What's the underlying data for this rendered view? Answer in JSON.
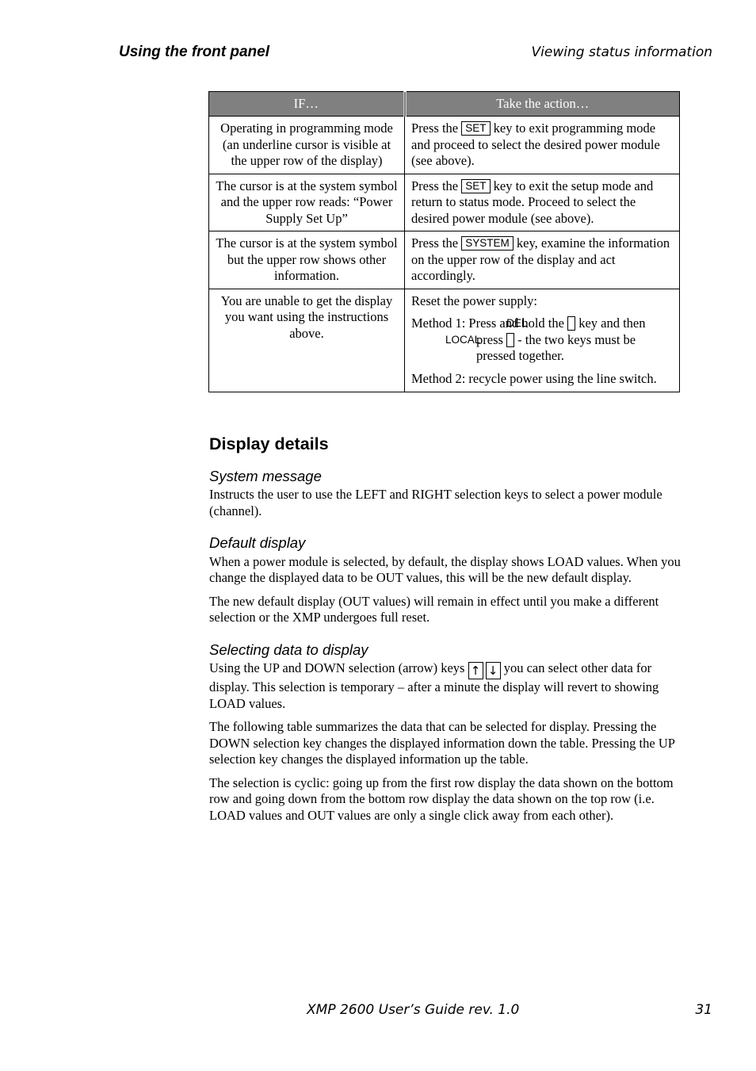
{
  "header": {
    "chapter": "Using the front panel",
    "section": "Viewing status information"
  },
  "table": {
    "headers": [
      "IF…",
      "Take the action…"
    ],
    "rows": [
      {
        "if": "Operating in programming mode (an underline cursor is visible at the upper row of the display)",
        "pre": "Press the",
        "key": "SET",
        "post": "key to exit programming mode and proceed to select the desired power module (see above)."
      },
      {
        "if": "The cursor is at the system symbol and the upper row reads: “Power Supply Set Up”",
        "pre": "Press the",
        "key": "SET",
        "post": "key to exit the setup mode and return to status mode. Proceed to select the desired power module (see above)."
      },
      {
        "if": "The cursor is at the system symbol but the upper row shows other information.",
        "pre": "Press the",
        "key": "SYSTEM",
        "post": "key, examine the information on the upper row of the display and act accordingly."
      }
    ],
    "last_row": {
      "if": "You are unable to get the display you want using the instructions above.",
      "intro": "Reset the power supply:",
      "m1_pre": "Method 1: Press and hold the",
      "m1_key1": "DEL",
      "m1_mid": "key and then press",
      "m1_key2": "LOCAL",
      "m1_post": "- the two keys must be pressed together.",
      "m2": "Method 2: recycle power using the line switch."
    }
  },
  "content": {
    "title": "Display details",
    "system_message": {
      "heading": "System message",
      "text": "Instructs the user to use the LEFT and RIGHT selection keys to select a power module (channel)."
    },
    "default_display": {
      "heading": "Default display",
      "p1": "When a power module is selected, by default, the display shows LOAD values. When you change the displayed data to be OUT values, this will be the new default display.",
      "p2": "The new default display (OUT values) will remain in effect until you make a different selection or the XMP undergoes full reset."
    },
    "selecting": {
      "heading": "Selecting data to display",
      "p1_pre": "Using the UP and DOWN selection (arrow) keys",
      "up": "↑",
      "down": "↓",
      "p1_post": "you can select other data for display. This selection is temporary – after a minute the display will revert to showing LOAD values.",
      "p2": "The following table summarizes the data that can be selected for display. Pressing the DOWN selection key changes the displayed information down the table. Pressing the UP selection key changes the displayed information up the table.",
      "p3": "The selection is cyclic: going up from the first row display the data shown on the bottom row and going down from the bottom row display the data shown on the top row (i.e. LOAD values and OUT values are only a single click away from each other)."
    }
  },
  "footer": {
    "title": "XMP 2600 User’s Guide rev. 1.0",
    "page": "31"
  }
}
